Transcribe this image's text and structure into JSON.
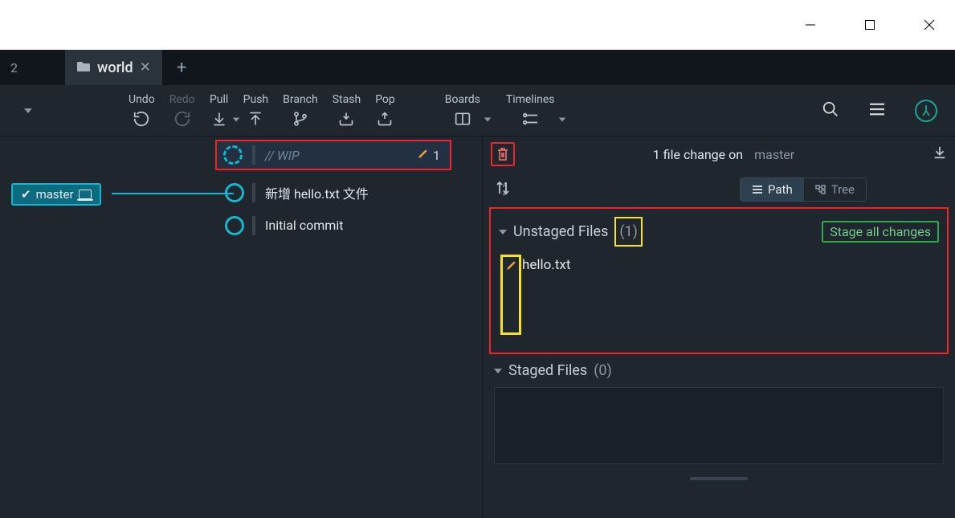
{
  "window": {
    "truncated_tab_suffix": "2",
    "active_tab": "world"
  },
  "toolbar": {
    "undo": "Undo",
    "redo": "Redo",
    "pull": "Pull",
    "push": "Push",
    "branch": "Branch",
    "stash": "Stash",
    "pop": "Pop",
    "boards": "Boards",
    "timelines": "Timelines"
  },
  "graph": {
    "branch_tag": "master",
    "wip_label": "// WIP",
    "wip_change_count": "1",
    "commits": [
      {
        "message": "新增 hello.txt 文件"
      },
      {
        "message": "Initial commit"
      }
    ]
  },
  "right_panel": {
    "summary_prefix": "1 file change on",
    "summary_branch": "master",
    "view_path": "Path",
    "view_tree": "Tree",
    "unstaged": {
      "title": "Unstaged Files",
      "count": "(1)",
      "stage_all": "Stage all changes",
      "files": [
        {
          "name": "hello.txt"
        }
      ]
    },
    "staged": {
      "title": "Staged Files",
      "count": "(0)"
    }
  }
}
